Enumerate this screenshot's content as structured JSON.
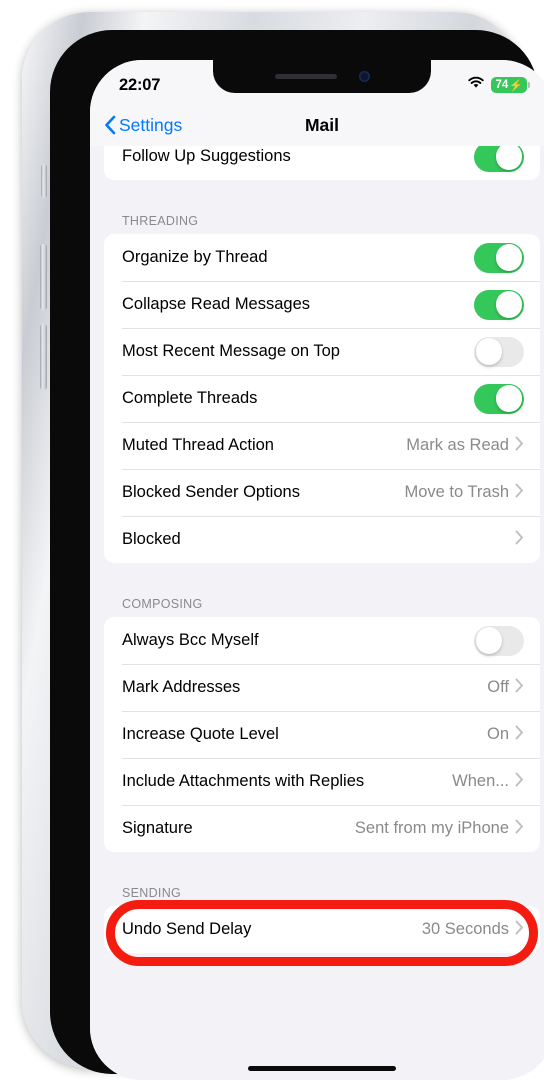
{
  "status_bar": {
    "time": "22:07",
    "wifi_icon": "wifi-icon",
    "battery_level": "74",
    "battery_bolt": "⚡",
    "battery_color": "#34C759"
  },
  "nav_bar": {
    "back_label": "Settings",
    "back_icon": "chevron-left-icon",
    "title": "Mail",
    "accent_color": "#007AFF"
  },
  "clipped_row": {
    "label": "Follow Up Suggestions",
    "toggle": "on"
  },
  "sections": [
    {
      "header": "THREADING",
      "rows": [
        {
          "label": "Organize by Thread",
          "type": "toggle",
          "toggle": "on"
        },
        {
          "label": "Collapse Read Messages",
          "type": "toggle",
          "toggle": "on"
        },
        {
          "label": "Most Recent Message on Top",
          "type": "toggle",
          "toggle": "off"
        },
        {
          "label": "Complete Threads",
          "type": "toggle",
          "toggle": "on"
        },
        {
          "label": "Muted Thread Action",
          "type": "disclosure",
          "value": "Mark as Read"
        },
        {
          "label": "Blocked Sender Options",
          "type": "disclosure",
          "value": "Move to Trash"
        },
        {
          "label": "Blocked",
          "type": "disclosure",
          "value": ""
        }
      ]
    },
    {
      "header": "COMPOSING",
      "rows": [
        {
          "label": "Always Bcc Myself",
          "type": "toggle",
          "toggle": "off"
        },
        {
          "label": "Mark Addresses",
          "type": "disclosure",
          "value": "Off"
        },
        {
          "label": "Increase Quote Level",
          "type": "disclosure",
          "value": "On"
        },
        {
          "label": "Include Attachments with Replies",
          "type": "disclosure",
          "value": "When..."
        },
        {
          "label": "Signature",
          "type": "disclosure",
          "value": "Sent from my iPhone"
        }
      ]
    },
    {
      "header": "SENDING",
      "highlighted": true,
      "rows": [
        {
          "label": "Undo Send Delay",
          "type": "disclosure",
          "value": "30 Seconds"
        }
      ]
    }
  ],
  "annotation": {
    "shape": "oval",
    "color": "#F41C10",
    "targets": "SENDING section and Undo Send Delay row"
  },
  "toggle_colors": {
    "on": "#34C759",
    "off": "#E9E9EA"
  }
}
